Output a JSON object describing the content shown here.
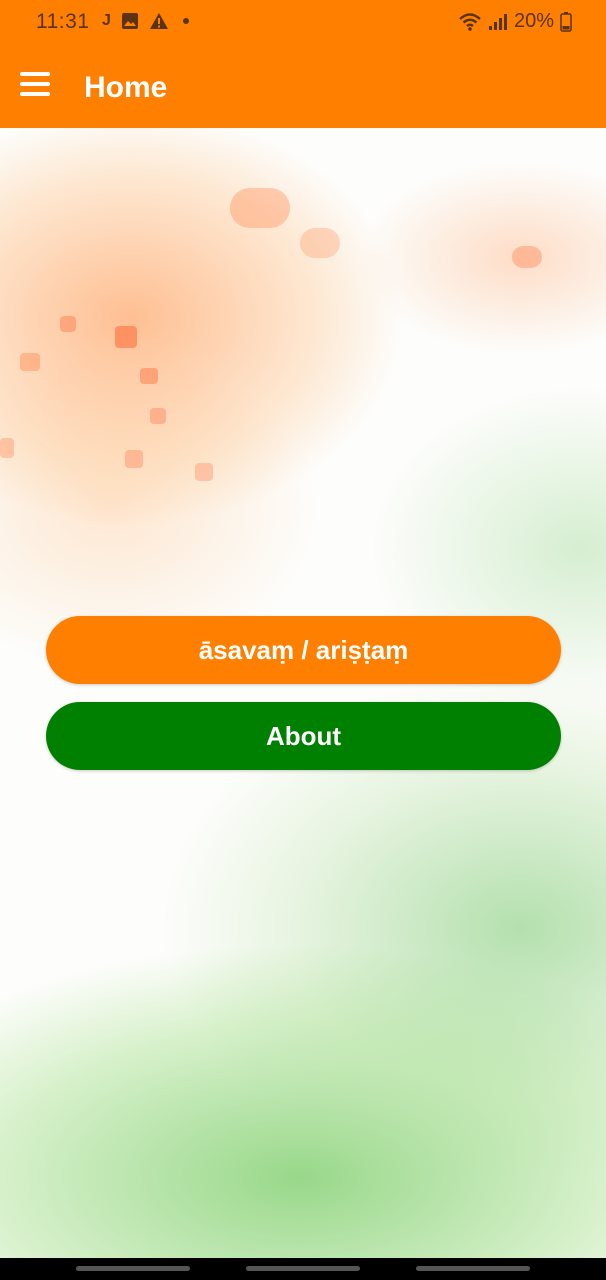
{
  "status_bar": {
    "time": "11:31",
    "notification_icons": [
      "j-app-icon",
      "image-icon",
      "warning-icon",
      "dot-icon"
    ],
    "battery_text": "20%",
    "system_icons": [
      "wifi-icon",
      "signal-icon",
      "battery-icon"
    ]
  },
  "app_bar": {
    "title": "Home",
    "menu_icon": "hamburger-menu-icon"
  },
  "buttons": {
    "asavam_label": "āsavaṃ / ariṣṭaṃ",
    "about_label": "About"
  },
  "colors": {
    "primary_orange": "#ff7f00",
    "primary_green": "#008000",
    "text_white": "#ffffff"
  }
}
